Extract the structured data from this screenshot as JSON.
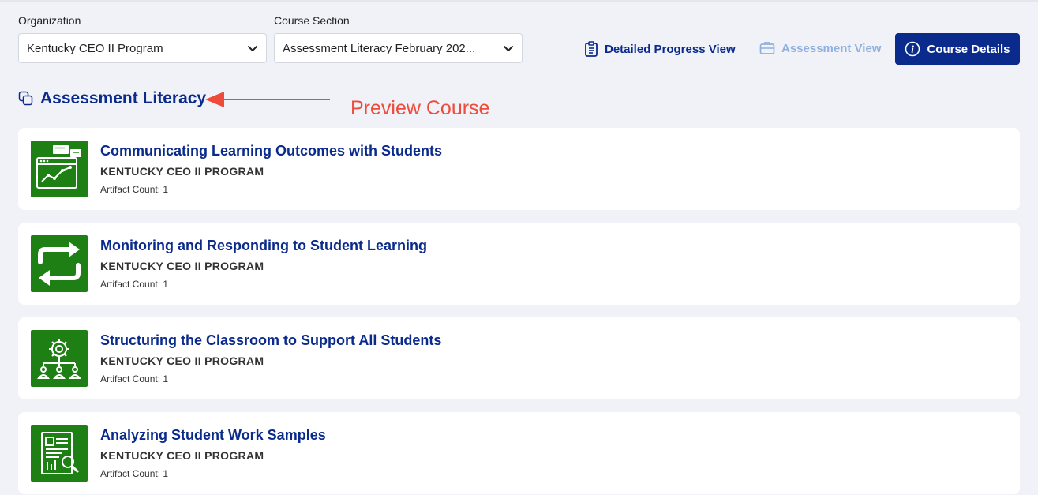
{
  "filters": {
    "organization": {
      "label": "Organization",
      "value": "Kentucky CEO II Program"
    },
    "course_section": {
      "label": "Course Section",
      "value": "Assessment Literacy February 202..."
    }
  },
  "toolbar": {
    "detailed_progress_label": "Detailed Progress View",
    "assessment_view_label": "Assessment View",
    "course_details_label": "Course Details"
  },
  "course": {
    "title": "Assessment Literacy",
    "annotation": "Preview Course"
  },
  "modules": [
    {
      "title": "Communicating Learning Outcomes with Students",
      "org": "KENTUCKY CEO II PROGRAM",
      "artifact_count": "Artifact Count: 1",
      "icon": "presentation-chart-icon"
    },
    {
      "title": "Monitoring and Responding to Student Learning",
      "org": "KENTUCKY CEO II PROGRAM",
      "artifact_count": "Artifact Count: 1",
      "icon": "loop-arrows-icon"
    },
    {
      "title": "Structuring the Classroom to Support All Students",
      "org": "KENTUCKY CEO II PROGRAM",
      "artifact_count": "Artifact Count: 1",
      "icon": "gear-people-icon"
    },
    {
      "title": "Analyzing Student Work Samples",
      "org": "KENTUCKY CEO II PROGRAM",
      "artifact_count": "Artifact Count: 1",
      "icon": "document-magnifier-icon"
    }
  ],
  "colors": {
    "brand_navy": "#0a2a8c",
    "muted_blue": "#8eb0e0",
    "thumb_green": "#1e7f15",
    "annotation_red": "#ef4b3a",
    "page_bg": "#f1f2f7"
  }
}
